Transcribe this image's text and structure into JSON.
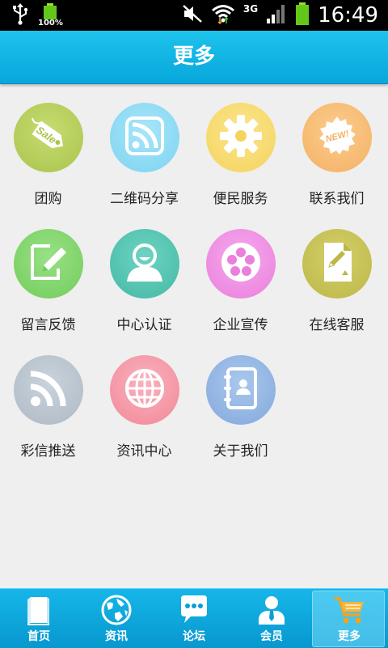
{
  "status_bar": {
    "battery_left_pct": "100%",
    "network": "3G",
    "time": "16:49"
  },
  "header": {
    "title": "更多"
  },
  "grid": [
    {
      "label": "团购",
      "icon": "sale-tag-icon",
      "color": "#b7cf5b"
    },
    {
      "label": "二维码分享",
      "icon": "rss-icon",
      "color": "#8fdcf5"
    },
    {
      "label": "便民服务",
      "icon": "gear-icon",
      "color": "#f7dc73"
    },
    {
      "label": "联系我们",
      "icon": "new-badge-icon",
      "color": "#f7bf79"
    },
    {
      "label": "留言反馈",
      "icon": "edit-note-icon",
      "color": "#86d671"
    },
    {
      "label": "中心认证",
      "icon": "user-icon",
      "color": "#56c7b4"
    },
    {
      "label": "企业宣传",
      "icon": "film-reel-icon",
      "color": "#f193e4"
    },
    {
      "label": "在线客服",
      "icon": "document-pencil-icon",
      "color": "#c6c253"
    },
    {
      "label": "彩信推送",
      "icon": "rss-icon",
      "color": "#bcc6d0"
    },
    {
      "label": "资讯中心",
      "icon": "globe-icon",
      "color": "#f69eac"
    },
    {
      "label": "关于我们",
      "icon": "contacts-book-icon",
      "color": "#96b8e3"
    }
  ],
  "tabbar": {
    "items": [
      {
        "label": "首页",
        "icon": "book-icon"
      },
      {
        "label": "资讯",
        "icon": "globe-icon"
      },
      {
        "label": "论坛",
        "icon": "chat-bubble-icon"
      },
      {
        "label": "会员",
        "icon": "member-icon"
      },
      {
        "label": "更多",
        "icon": "cart-icon",
        "active": true
      }
    ]
  }
}
